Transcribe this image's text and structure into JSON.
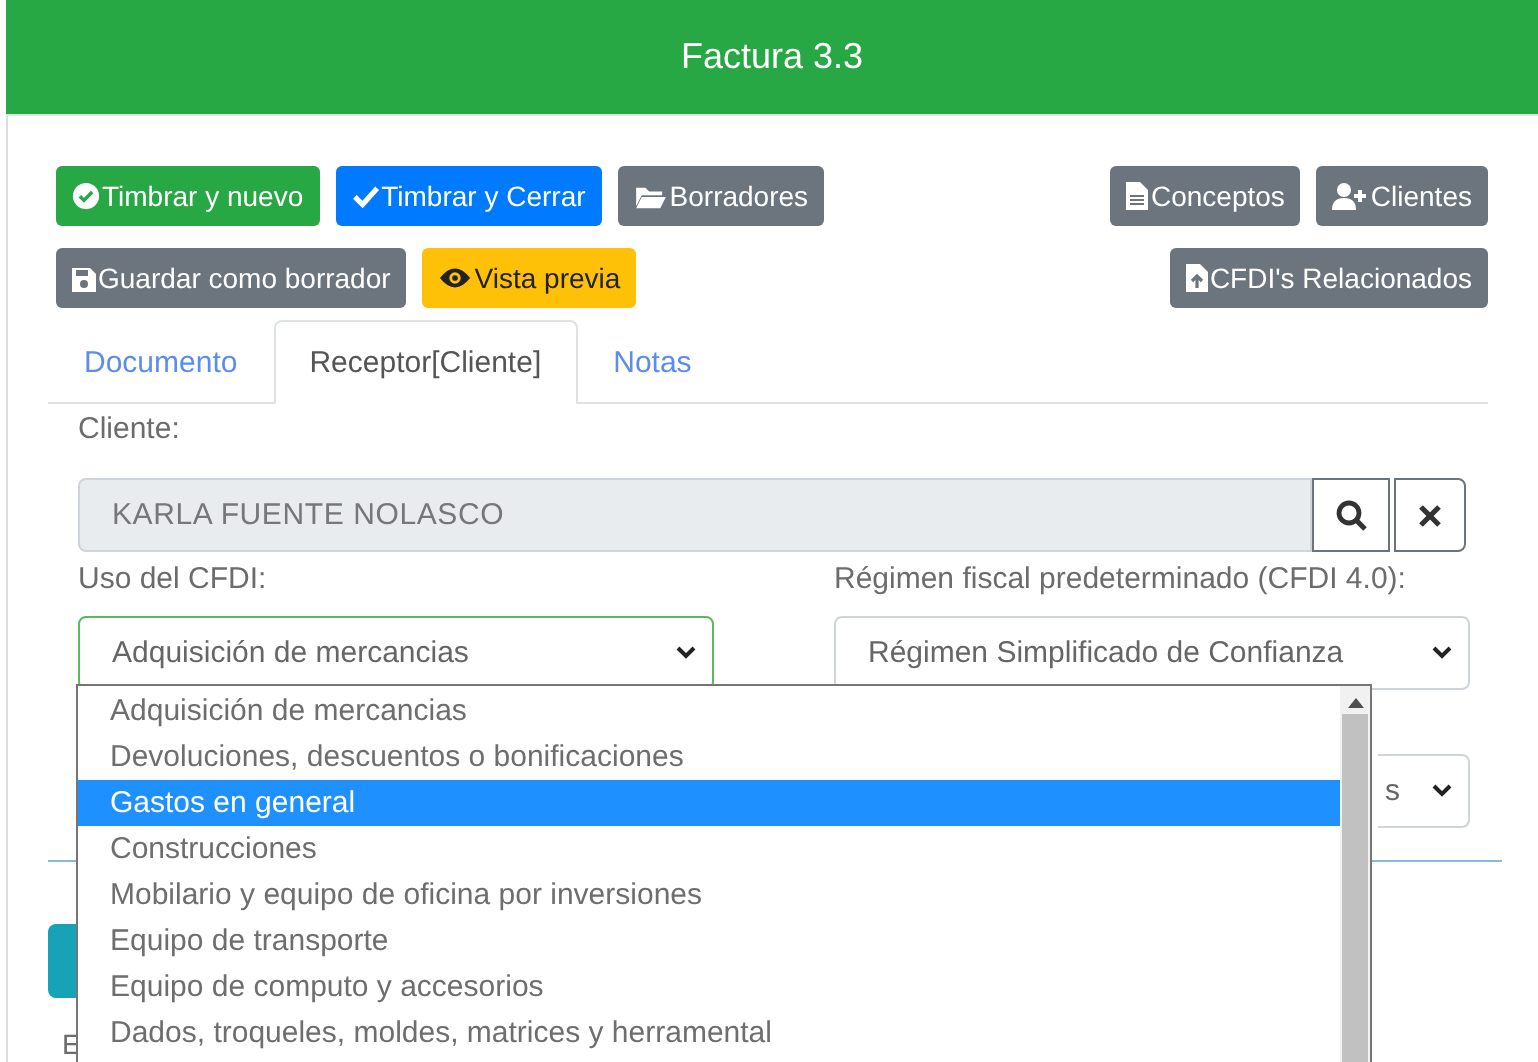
{
  "header": {
    "title": "Factura 3.3"
  },
  "toolbar": {
    "left": [
      [
        {
          "label": "Timbrar y nuevo",
          "kind": "success"
        },
        {
          "label": "Timbrar y Cerrar",
          "kind": "primary"
        },
        {
          "label": "Borradores",
          "kind": "secondary"
        }
      ],
      [
        {
          "label": "Guardar como borrador",
          "kind": "secondary"
        },
        {
          "label": "Vista previa",
          "kind": "warning"
        }
      ]
    ],
    "right": [
      [
        {
          "label": "Conceptos",
          "kind": "secondary"
        },
        {
          "label": "Clientes",
          "kind": "secondary"
        }
      ],
      [
        {
          "label": "CFDI's Relacionados",
          "kind": "secondary"
        }
      ]
    ]
  },
  "tabs": [
    {
      "label": "Documento",
      "selected": false
    },
    {
      "label": "Receptor[Cliente]",
      "selected": true
    },
    {
      "label": "Notas",
      "selected": false
    }
  ],
  "cliente": {
    "label": "Cliente:",
    "value": "KARLA FUENTE NOLASCO"
  },
  "uso_cfdi": {
    "label": "Uso del CFDI:",
    "value": "Adquisición de mercancias"
  },
  "regimen": {
    "label": "Régimen fiscal predeterminado (CFDI 4.0):",
    "value": "Régimen Simplificado de Confianza"
  },
  "select_behind": {
    "value": "s"
  },
  "footer_text": "E",
  "dropdown": [
    {
      "label": "Adquisición de mercancias",
      "selected": false
    },
    {
      "label": "Devoluciones, descuentos o bonificaciones",
      "selected": false
    },
    {
      "label": "Gastos en general",
      "selected": true
    },
    {
      "label": "Construcciones",
      "selected": false
    },
    {
      "label": "Mobilario y equipo de oficina por inversiones",
      "selected": false
    },
    {
      "label": "Equipo de transporte",
      "selected": false
    },
    {
      "label": "Equipo de computo y accesorios",
      "selected": false
    },
    {
      "label": "Dados, troqueles, moldes, matrices y herramental",
      "selected": false
    }
  ]
}
